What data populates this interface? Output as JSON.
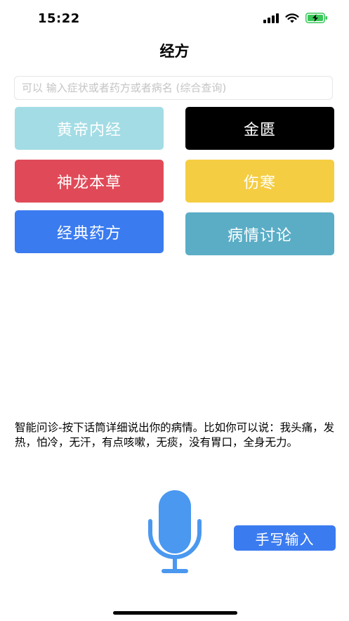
{
  "status_bar": {
    "time": "15:22",
    "icons": [
      "cellular-signal-icon",
      "wifi-icon",
      "battery-charging-icon"
    ],
    "battery_color": "#38c759"
  },
  "nav": {
    "title": "经方"
  },
  "search": {
    "placeholder": "可以 输入症状或者药方或者病名 (综合查询)"
  },
  "tiles": [
    {
      "label": "黄帝内经",
      "color": "#a3dce4"
    },
    {
      "label": "金匮",
      "color": "#000000"
    },
    {
      "label": "神龙本草",
      "color": "#e04a58"
    },
    {
      "label": "伤寒",
      "color": "#f5cd42"
    },
    {
      "label": "经典药方",
      "color": "#3a7bf0"
    },
    {
      "label": "病情讨论",
      "color": "#5badc6"
    }
  ],
  "hint": {
    "text": "智能问诊-按下话筒详细说出你的病情。比如你可以说：我头痛，发热，怕冷，无汗，有点咳嗽，无痰，没有胃口，全身无力。"
  },
  "voice": {
    "icon": "microphone-icon",
    "color": "#4a98f0"
  },
  "handwrite": {
    "label": "手写输入"
  }
}
